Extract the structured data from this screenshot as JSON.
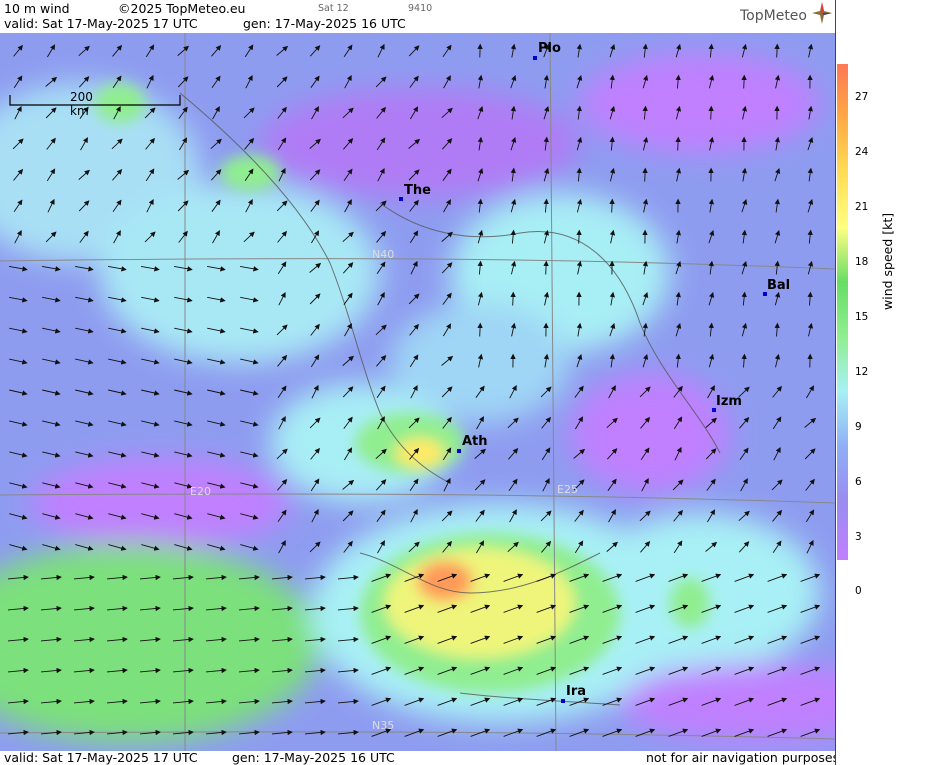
{
  "header": {
    "product": "10 m wind",
    "copyright": "©2025 TopMeteo.eu",
    "valid": "valid:  Sat  17-May-2025  17 UTC",
    "gen": "gen: 17-May-2025 16 UTC",
    "sat": "Sat 12",
    "code": "9410",
    "logo": "TopMeteo"
  },
  "footer": {
    "valid": "valid:  Sat  17-May-2025  17 UTC",
    "gen": "gen: 17-May-2025 16 UTC",
    "notice": "not for air navigation purposes"
  },
  "scale_label": "200 km",
  "legend": {
    "title": "wind speed [kt]",
    "ticks": [
      "27",
      "24",
      "21",
      "18",
      "15",
      "12",
      "9",
      "6",
      "3",
      "0"
    ]
  },
  "cities": [
    {
      "name": "Plo"
    },
    {
      "name": "The"
    },
    {
      "name": "Bal"
    },
    {
      "name": "Izm"
    },
    {
      "name": "Ath"
    },
    {
      "name": "Ira"
    }
  ],
  "grid_labels": {
    "n40": "N40",
    "n35": "N35",
    "e20": "E20",
    "e25": "E25"
  },
  "colors": {
    "c0": "#c080ff",
    "c3": "#9a8cf0",
    "c6": "#8fb0f5",
    "c9": "#a8f0f5",
    "c12": "#90ee90",
    "c15": "#66dd66",
    "c18": "#ffff80",
    "c21": "#ffdd55",
    "c24": "#ffaa44",
    "c27": "#ff7755"
  }
}
